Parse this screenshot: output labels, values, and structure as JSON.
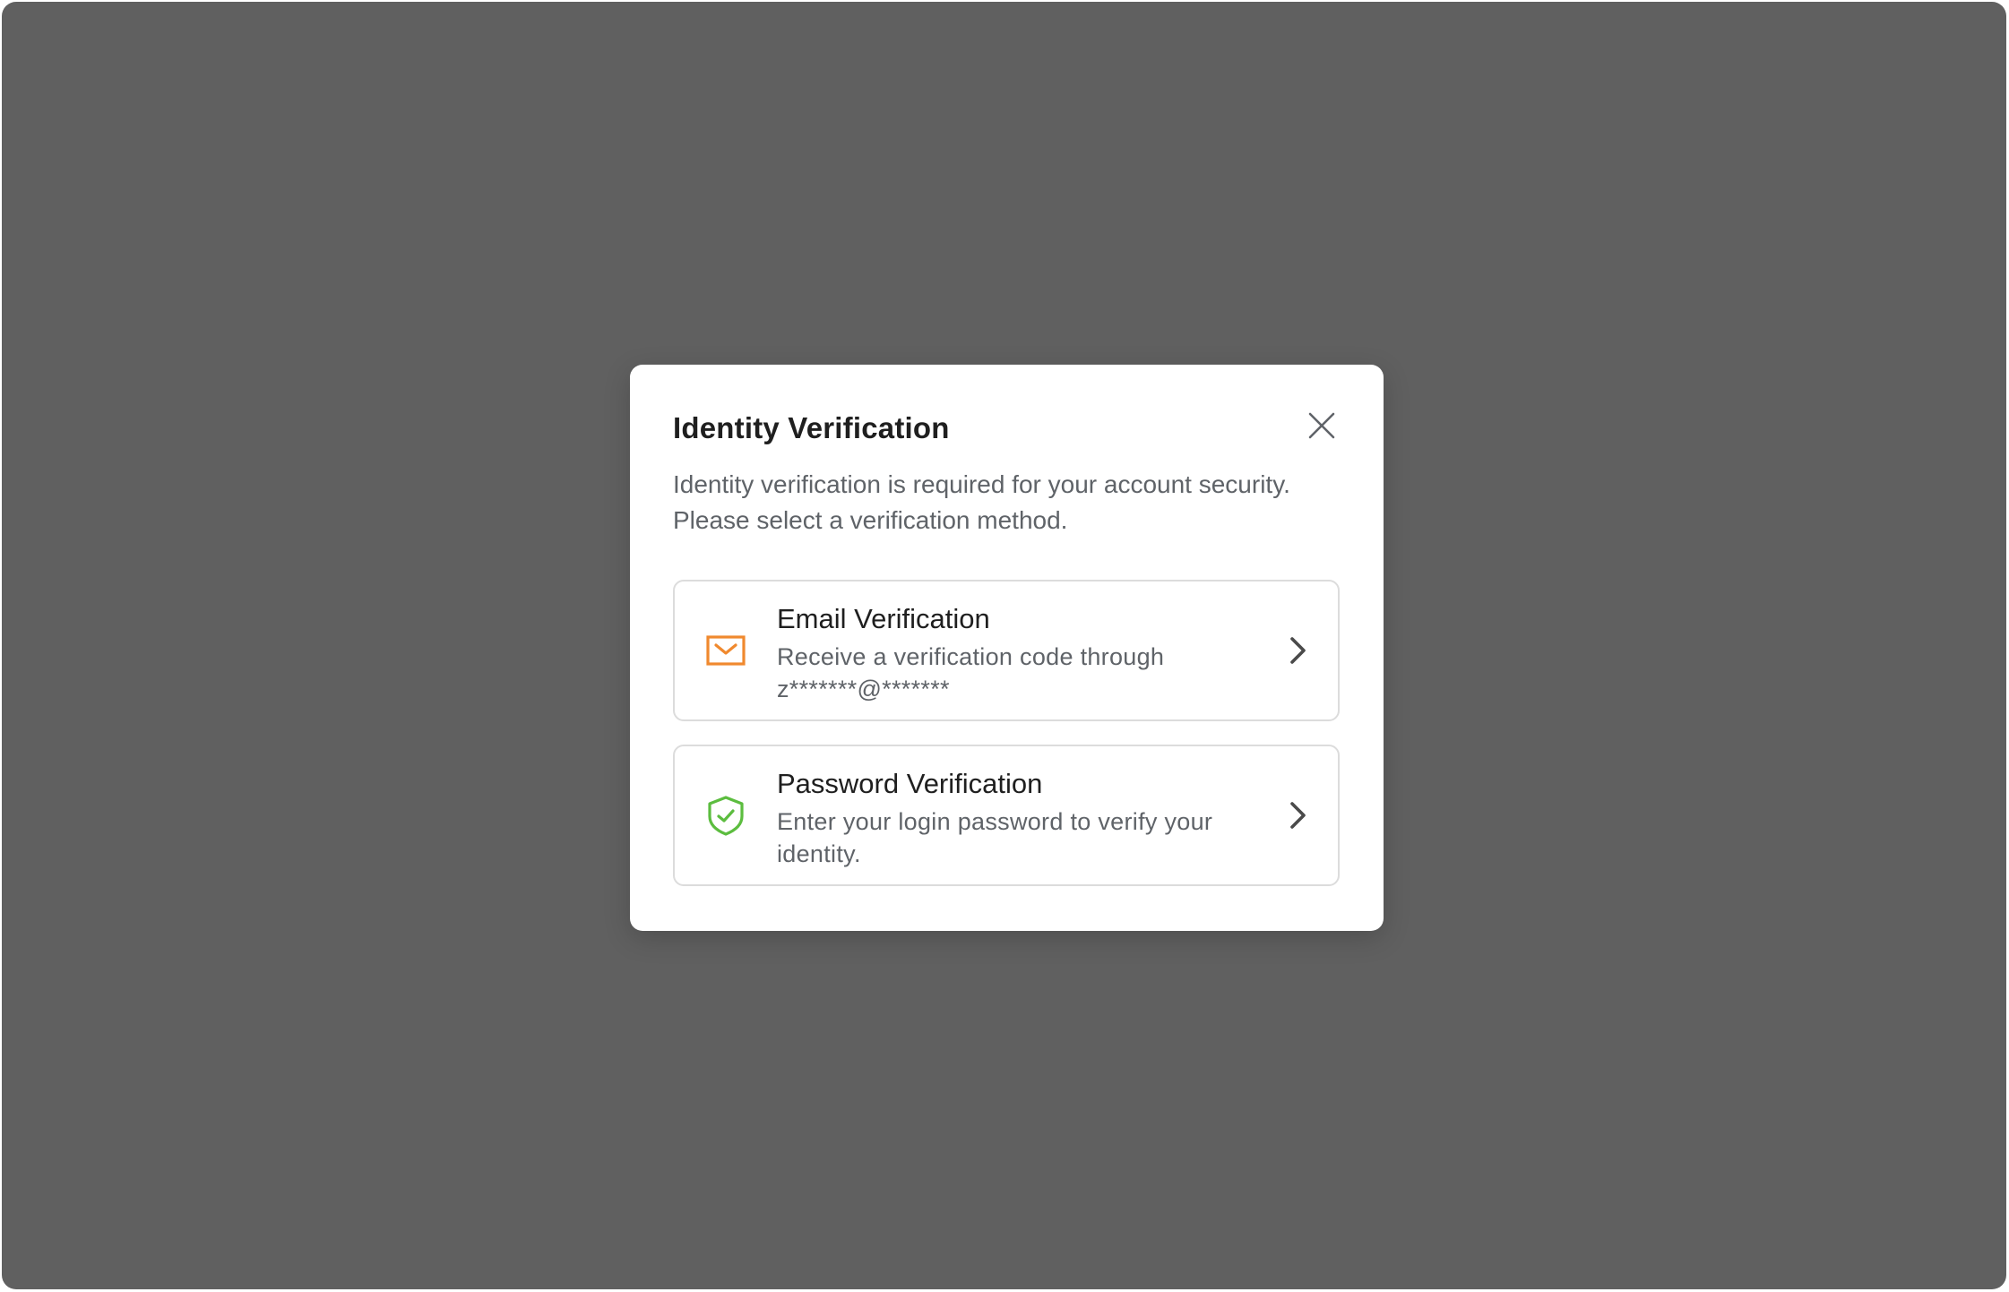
{
  "dialog": {
    "title": "Identity Verification",
    "description": "Identity verification is required for your account security. Please select a verification method.",
    "close_icon": "close-icon",
    "options": [
      {
        "title": "Email Verification",
        "description": "Receive a verification code through z*******@*******",
        "icon": "envelope-icon",
        "icon_color": "#F0892E"
      },
      {
        "title": "Password Verification",
        "description": "Enter your login password to verify your identity.",
        "icon": "shield-check-icon",
        "icon_color": "#5CBD3F"
      }
    ]
  },
  "colors": {
    "overlay": "#606060",
    "modal_background": "#FFFFFF",
    "title_text": "#1F1F1F",
    "secondary_text": "#5F6368",
    "option_border": "#DCDCDC"
  }
}
